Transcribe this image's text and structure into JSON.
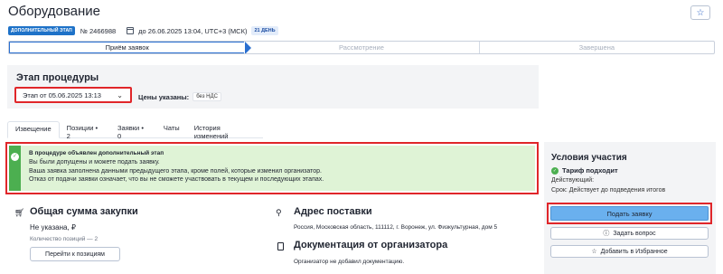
{
  "header": {
    "title": "Оборудование",
    "favorite_icon": "star-icon",
    "stage_badge": "ДОПОЛНИТЕЛЬНЫЙ ЭТАП",
    "number": "№ 2466988",
    "deadline": "до 26.06.2025 13:04, UTC+3 (МСК)",
    "days_badge": "21 ДЕНЬ"
  },
  "steps": [
    {
      "label": "Приём заявок",
      "active": true
    },
    {
      "label": "Рассмотрение",
      "active": false
    },
    {
      "label": "Завершена",
      "active": false
    }
  ],
  "procedure": {
    "title": "Этап процедуры",
    "stage_value": "Этап от 05.06.2025 13:13",
    "prices_label": "Цены указаны:",
    "prices_value": "без НДС"
  },
  "tabs": [
    {
      "label": "Извещение",
      "active": true
    },
    {
      "label": "Позиции • 2",
      "active": false
    },
    {
      "label": "Заявки • 0",
      "active": false
    },
    {
      "label": "Чаты",
      "active": false
    },
    {
      "label": "История изменений",
      "active": false
    }
  ],
  "notice": {
    "title": "В процедуре объявлен дополнительный этап",
    "lines": [
      "Вы были допущены и можете подать заявку.",
      "Ваша заявка заполнена данными предыдущего этапа, кроме полей, которые изменил организатор.",
      "Отказ от подачи заявки означает, что вы не сможете участвовать в текущем и последующих этапах."
    ],
    "colors": {
      "bg": "#dff3d6",
      "accent": "#4caf50",
      "highlight": "#e0262a"
    }
  },
  "sum": {
    "title": "Общая сумма закупки",
    "value": "Не указана, ₽",
    "count": "Количество позиций — 2",
    "button": "Перейти к позициям"
  },
  "delivery": {
    "title": "Адрес поставки",
    "address": "Россия, Московская область, 111112, г. Воронеж, ул. Физкультурная, дом 5"
  },
  "docs": {
    "title": "Документация от организатора",
    "text": "Организатор не добавил документацию."
  },
  "side": {
    "title": "Условия участия",
    "tariff": "Тариф подходит",
    "valid_label": "Действующий:",
    "term": "Срок: Действует до подведения итогов",
    "apply_button": "Подать заявку",
    "ask_button": "Задать вопрос",
    "favorite_button": "Добавить в Избранное",
    "colors": {
      "apply": "#6ab0ee"
    }
  }
}
